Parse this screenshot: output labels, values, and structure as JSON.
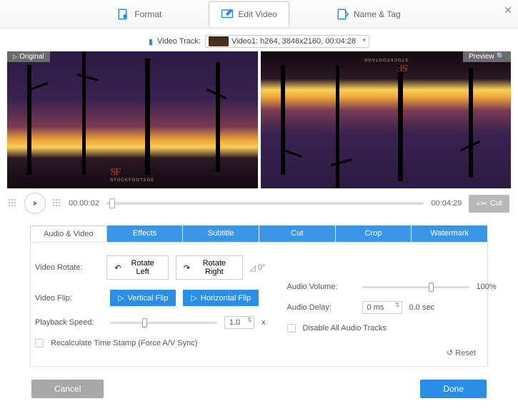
{
  "header": {
    "tabs": {
      "format": "Format",
      "edit_video": "Edit Video",
      "name_tag": "Name & Tag"
    }
  },
  "video_track": {
    "label": "Video Track:",
    "value": "Video1: h264, 3846x2160, 00:04:28"
  },
  "preview": {
    "original_tag": "Original",
    "preview_tag": "Preview"
  },
  "playback": {
    "current_time": "00:00:02",
    "total_time": "00:04:29",
    "cut_label": "Cut"
  },
  "subtabs": {
    "audio_video": "Audio & Video",
    "effects": "Effects",
    "subtitle": "Subtitle",
    "cut": "Cut",
    "crop": "Crop",
    "watermark": "Watermark"
  },
  "edit": {
    "video_rotate_label": "Video Rotate:",
    "rotate_left": "Rotate Left",
    "rotate_right": "Rotate Right",
    "angle": "0°",
    "video_flip_label": "Video Flip:",
    "vertical_flip": "Vertical Flip",
    "horizontal_flip": "Horizontal Flip",
    "playback_speed_label": "Playback Speed:",
    "speed_value": "1.0",
    "speed_unit": "x",
    "recalc_label": "Recalculate Time Stamp (Force A/V Sync)",
    "audio_volume_label": "Audio Volume:",
    "volume_value": "100%",
    "audio_delay_label": "Audio Delay:",
    "delay_value": "0 ms",
    "delay_sec": "0.0 sec",
    "disable_audio_label": "Disable All Audio Tracks",
    "reset": "Reset"
  },
  "footer": {
    "cancel": "Cancel",
    "done": "Done"
  }
}
